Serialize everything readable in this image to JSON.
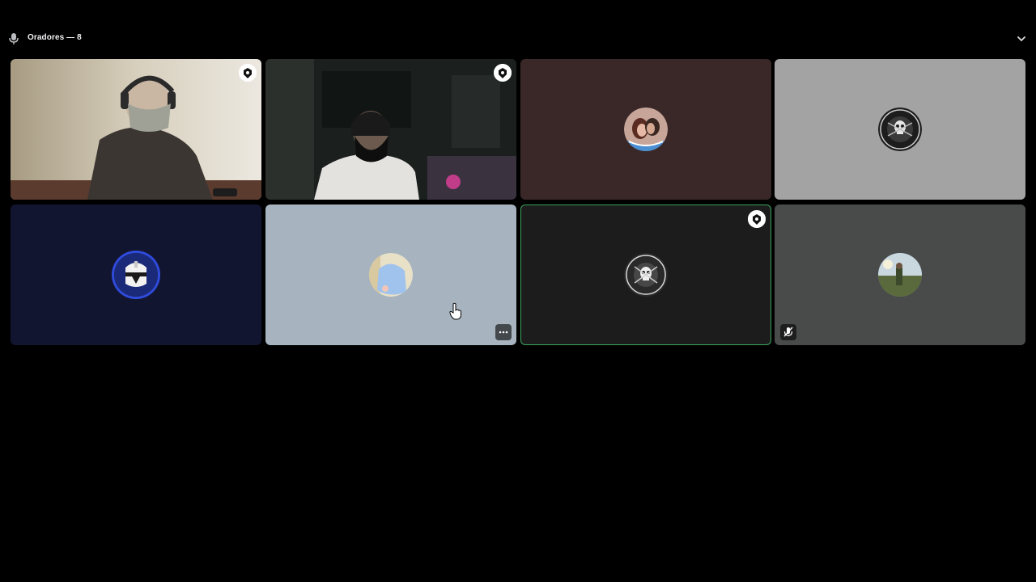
{
  "stage": {
    "header": {
      "title": "Oradores — 8",
      "mic_icon": "microphone-icon",
      "collapse_icon": "chevron-down-icon"
    },
    "participants": [
      {
        "kind": "video",
        "background": "#cfc6b4",
        "badge": "stage-moderator-icon",
        "speaking": false
      },
      {
        "kind": "video",
        "background": "#1a1f1e",
        "badge": "stage-moderator-icon",
        "speaking": false
      },
      {
        "kind": "avatar",
        "background": "#3a2828",
        "avatar": "couple-avatar",
        "speaking": false
      },
      {
        "kind": "avatar",
        "background": "#a3a3a3",
        "avatar": "clan-azteca-beto-avatar",
        "speaking": false
      },
      {
        "kind": "avatar",
        "background": "#121530",
        "avatar": "clone-trooper-avatar",
        "speaking": false
      },
      {
        "kind": "avatar",
        "background": "#a7b4bf",
        "avatar": "blue-figure-avatar",
        "speaking": false,
        "more_button": "more-options-icon"
      },
      {
        "kind": "avatar",
        "background": "#1c1c1c",
        "avatar": "clan-azteca-sora-avatar",
        "badge": "stage-moderator-icon",
        "speaking": true,
        "speaking_color": "#3ba55d"
      },
      {
        "kind": "avatar",
        "background": "#494b4a",
        "avatar": "outdoor-photo-avatar",
        "speaking": false,
        "muted": "mic-muted-icon"
      }
    ]
  }
}
